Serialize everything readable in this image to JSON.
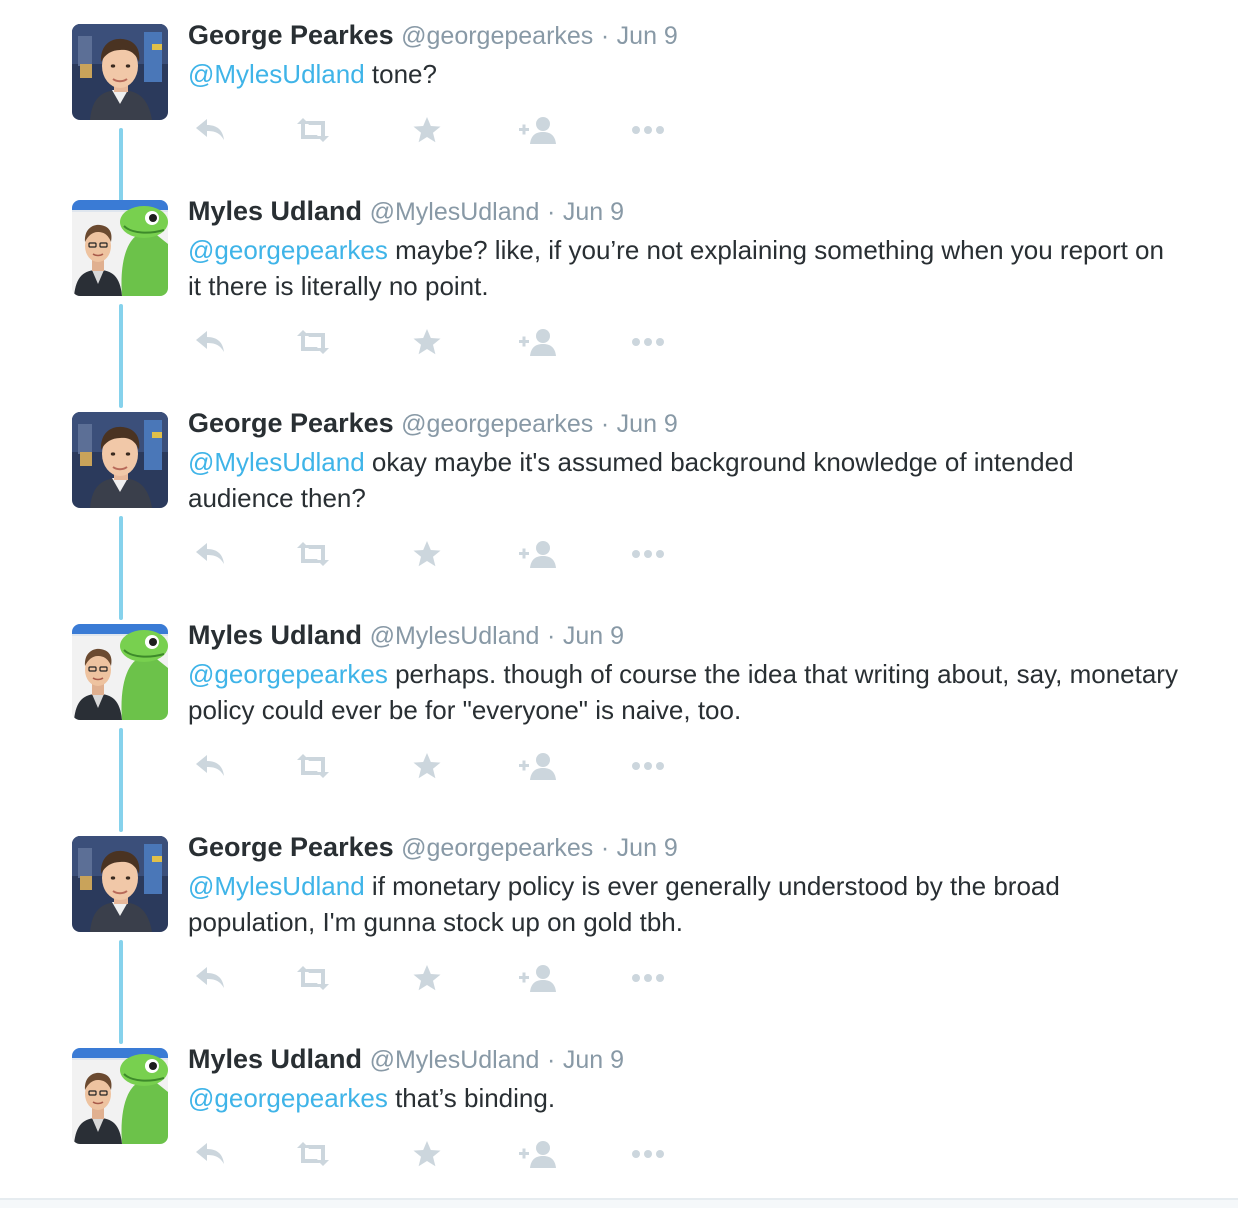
{
  "accent_color": "#3fb4e8",
  "icon_color": "#ccd6dd",
  "thread_line_color": "#86d2ec",
  "tweets": [
    {
      "name": "George Pearkes",
      "handle": "@georgepearkes",
      "separator": "·",
      "time": "Jun 9",
      "mention": "@MylesUdland",
      "text": " tone?"
    },
    {
      "name": "Myles Udland",
      "handle": "@MylesUdland",
      "separator": "·",
      "time": "Jun 9",
      "mention": "@georgepearkes",
      "text": " maybe? like, if you’re not explaining something when you report on it there is literally no point."
    },
    {
      "name": "George Pearkes",
      "handle": "@georgepearkes",
      "separator": "·",
      "time": "Jun 9",
      "mention": "@MylesUdland",
      "text": " okay maybe it's assumed background knowledge of intended audience then?"
    },
    {
      "name": "Myles Udland",
      "handle": "@MylesUdland",
      "separator": "·",
      "time": "Jun 9",
      "mention": "@georgepearkes",
      "text": " perhaps. though of course the idea that writing about, say, monetary policy could ever be for \"everyone\" is naive, too."
    },
    {
      "name": "George Pearkes",
      "handle": "@georgepearkes",
      "separator": "·",
      "time": "Jun 9",
      "mention": "@MylesUdland",
      "text": " if monetary policy is ever generally understood by the broad population, I'm gunna stock up on gold tbh."
    },
    {
      "name": "Myles Udland",
      "handle": "@MylesUdland",
      "separator": "·",
      "time": "Jun 9",
      "mention": "@georgepearkes",
      "text": " that’s binding."
    }
  ],
  "action_icons": [
    "reply-icon",
    "retweet-icon",
    "like-icon",
    "follow-icon",
    "more-icon"
  ]
}
